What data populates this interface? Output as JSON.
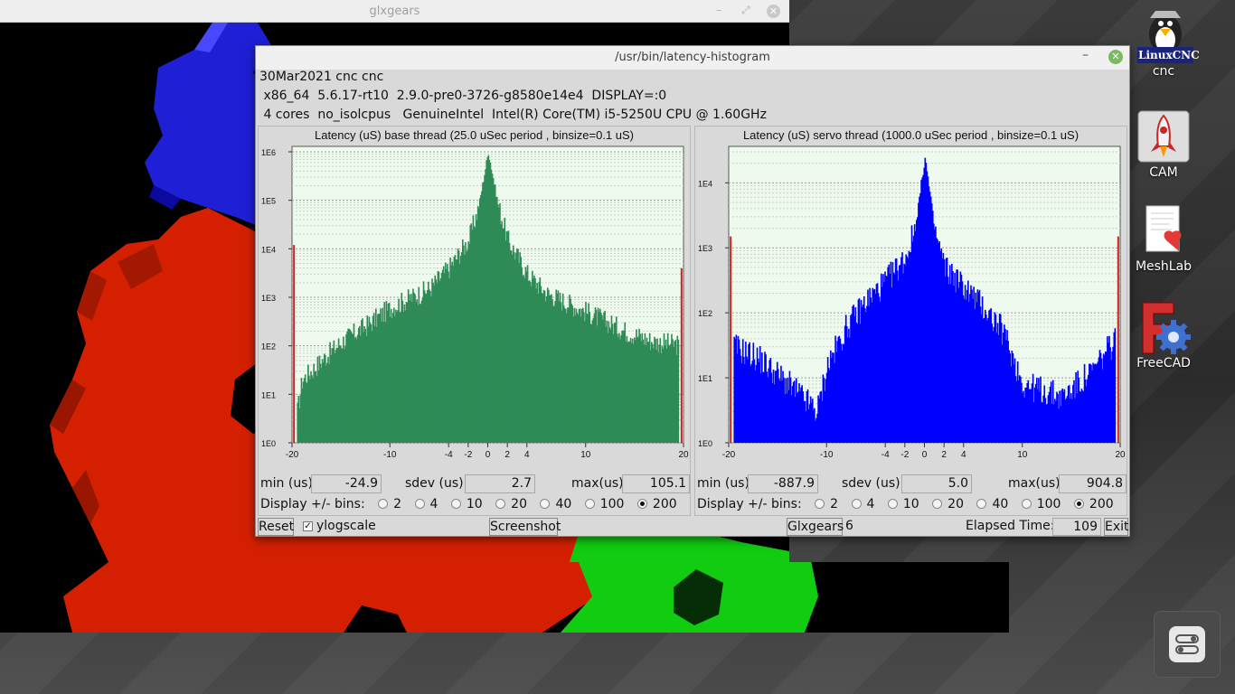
{
  "glxgears": {
    "title": "glxgears",
    "controls": {
      "minimize": "–",
      "maximize": "⤢",
      "close": "✕"
    }
  },
  "desktop_icons": [
    {
      "label": "cnc",
      "badge": "LinuxCNC",
      "icon": "linuxcnc-penguin-icon"
    },
    {
      "label": "CAM",
      "icon": "rocket-icon"
    },
    {
      "label": "MeshLab",
      "icon": "meshlab-document-heart-icon"
    },
    {
      "label": "FreeCAD",
      "icon": "freecad-gear-icon"
    }
  ],
  "latency_window": {
    "title": "/usr/bin/latency-histogram",
    "minimize": "–",
    "close": "✕",
    "info": {
      "date_line": "30Mar2021 cnc cnc",
      "kernel_line": " x86_64  5.6.17-rt10  2.9.0-pre0-3726-g8580e14e4  DISPLAY=:0",
      "cpu_line": " 4 cores  no_isolcpus   GenuineIntel  Intel(R) Core(TM) i5-5250U CPU @ 1.60GHz"
    },
    "base": {
      "title": "Latency (uS) base thread (25.0 uSec period , binsize=0.1 uS)",
      "min_label": "min (us)",
      "min_value": "-24.9",
      "sdev_label": "sdev (us):",
      "sdev_value": "2.7",
      "max_label": "max(us)",
      "max_value": "105.1",
      "bins_label": "Display +/- bins:",
      "bins": [
        "2",
        "4",
        "10",
        "20",
        "40",
        "100",
        "200"
      ],
      "selected_bin": "200",
      "color": "#2e8b57"
    },
    "servo": {
      "title": "Latency (uS) servo thread (1000.0 uSec period , binsize=0.1 uS)",
      "min_label": "min (us)",
      "min_value": "-887.9",
      "sdev_label": "sdev (us):",
      "sdev_value": "5.0",
      "max_label": "max(us)",
      "max_value": "904.8",
      "bins_label": "Display +/- bins:",
      "bins": [
        "2",
        "4",
        "10",
        "20",
        "40",
        "100",
        "200"
      ],
      "selected_bin": "200",
      "color": "#0000ff"
    },
    "bottom": {
      "reset": "Reset",
      "ylogscale": "ylogscale",
      "ylog_checked": "✓",
      "screenshot": "Screenshot",
      "glxgears": "Glxgears",
      "glxgears_count": "6",
      "elapsed_label": "Elapsed Time:",
      "elapsed_value": "109",
      "exit": "Exit"
    }
  },
  "chart_data": [
    {
      "type": "bar",
      "title": "Latency (uS) base thread (25.0 uSec period , binsize=0.1 uS)",
      "x_ticks": [
        "-20",
        "-10",
        "-4",
        "-2",
        "0",
        "2",
        "4",
        "10",
        "20"
      ],
      "y_ticks": [
        "1E0",
        "1E1",
        "1E2",
        "1E3",
        "1E4",
        "1E5",
        "1E6"
      ],
      "y_scale": "log",
      "xlim": [
        -20,
        20
      ],
      "ylim": [
        1,
        1000000
      ],
      "grid": true,
      "color": "#2e8b57",
      "envelope": [
        {
          "x": -20,
          "y": 1
        },
        {
          "x": -19,
          "y": 20
        },
        {
          "x": -17,
          "y": 50
        },
        {
          "x": -15,
          "y": 120
        },
        {
          "x": -12,
          "y": 300
        },
        {
          "x": -10,
          "y": 600
        },
        {
          "x": -6,
          "y": 1500
        },
        {
          "x": -4,
          "y": 4000
        },
        {
          "x": -2,
          "y": 15000
        },
        {
          "x": -1,
          "y": 70000
        },
        {
          "x": 0,
          "y": 1000000
        },
        {
          "x": 1,
          "y": 80000
        },
        {
          "x": 2,
          "y": 15000
        },
        {
          "x": 4,
          "y": 3000
        },
        {
          "x": 6,
          "y": 1200
        },
        {
          "x": 10,
          "y": 500
        },
        {
          "x": 14,
          "y": 200
        },
        {
          "x": 17,
          "y": 120
        },
        {
          "x": 20,
          "y": 100
        }
      ],
      "outliers": [
        {
          "x": -19.8,
          "y": 12000
        },
        {
          "x": 19.8,
          "y": 4000
        }
      ]
    },
    {
      "type": "bar",
      "title": "Latency (uS) servo thread (1000.0 uSec period , binsize=0.1 uS)",
      "x_ticks": [
        "-20",
        "-10",
        "-4",
        "-2",
        "0",
        "2",
        "4",
        "10",
        "20"
      ],
      "y_ticks": [
        "1E0",
        "1E1",
        "1E2",
        "1E3",
        "1E4"
      ],
      "y_scale": "log",
      "xlim": [
        -20,
        20
      ],
      "ylim": [
        1,
        30000
      ],
      "grid": true,
      "color": "#0000ff",
      "envelope": [
        {
          "x": -20,
          "y": 1
        },
        {
          "x": -19.5,
          "y": 30
        },
        {
          "x": -17,
          "y": 20
        },
        {
          "x": -14,
          "y": 8
        },
        {
          "x": -11,
          "y": 3
        },
        {
          "x": -10,
          "y": 15
        },
        {
          "x": -8,
          "y": 60
        },
        {
          "x": -6,
          "y": 150
        },
        {
          "x": -4,
          "y": 300
        },
        {
          "x": -2,
          "y": 700
        },
        {
          "x": -1,
          "y": 2000
        },
        {
          "x": 0,
          "y": 25000
        },
        {
          "x": 1,
          "y": 1800
        },
        {
          "x": 2,
          "y": 500
        },
        {
          "x": 4,
          "y": 250
        },
        {
          "x": 6,
          "y": 120
        },
        {
          "x": 8,
          "y": 50
        },
        {
          "x": 10,
          "y": 8
        },
        {
          "x": 14,
          "y": 5
        },
        {
          "x": 17,
          "y": 12
        },
        {
          "x": 19.5,
          "y": 40
        },
        {
          "x": 20,
          "y": 1
        }
      ],
      "outliers": [
        {
          "x": -19.8,
          "y": 1500
        },
        {
          "x": 19.8,
          "y": 1500
        }
      ]
    }
  ]
}
